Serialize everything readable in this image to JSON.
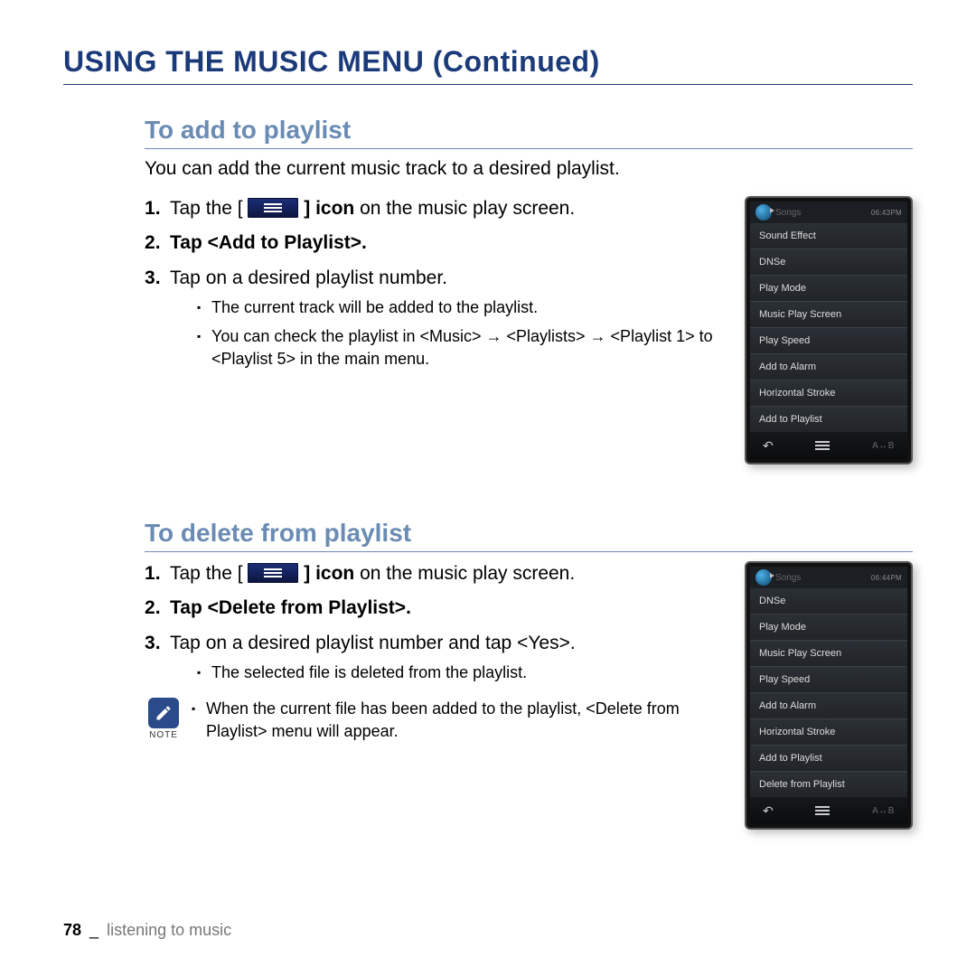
{
  "title": "USING THE MUSIC MENU (Continued)",
  "sec1": {
    "heading": "To add to playlist",
    "lead": "You can add the current music track to a desired playlist.",
    "step1_pre": "Tap the [",
    "step1_post": " ] icon",
    "step1_tail": " on the music play screen.",
    "step2_pre": "Tap ",
    "step2_bold": "<Add to Playlist>",
    "step2_post": ".",
    "step3": "Tap on a desired playlist number.",
    "sub1": "The current track will be added to the playlist.",
    "sub2": "You can check the playlist in <Music> → <Playlists> → <Playlist 1> to <Playlist 5> in the main menu."
  },
  "sec2": {
    "heading": "To delete from playlist",
    "step1_pre": "Tap the [",
    "step1_post": " ] icon",
    "step1_tail": " on the music play screen.",
    "step2_pre": "Tap ",
    "step2_bold": "<Delete from Playlist>",
    "step2_post": ".",
    "step3": "Tap on a desired playlist number and tap <Yes>.",
    "sub1": "The selected file is deleted from the playlist.",
    "note_label": "NOTE",
    "note_text": "When the current file has been added to the playlist, <Delete from Playlist> menu will appear."
  },
  "device1": {
    "status_title": "Songs",
    "time": "06:43PM",
    "items": [
      "Sound Effect",
      "DNSe",
      "Play Mode",
      "Music Play Screen",
      "Play Speed",
      "Add to Alarm",
      "Horizontal Stroke",
      "Add to Playlist"
    ],
    "nav_ab": "A↔B"
  },
  "device2": {
    "status_title": "Songs",
    "time": "06:44PM",
    "items": [
      "DNSe",
      "Play Mode",
      "Music Play Screen",
      "Play Speed",
      "Add to Alarm",
      "Horizontal Stroke",
      "Add to Playlist",
      "Delete from Playlist"
    ],
    "nav_ab": "A↔B"
  },
  "footer": {
    "page": "78",
    "sep": "_",
    "title": "listening to music"
  }
}
